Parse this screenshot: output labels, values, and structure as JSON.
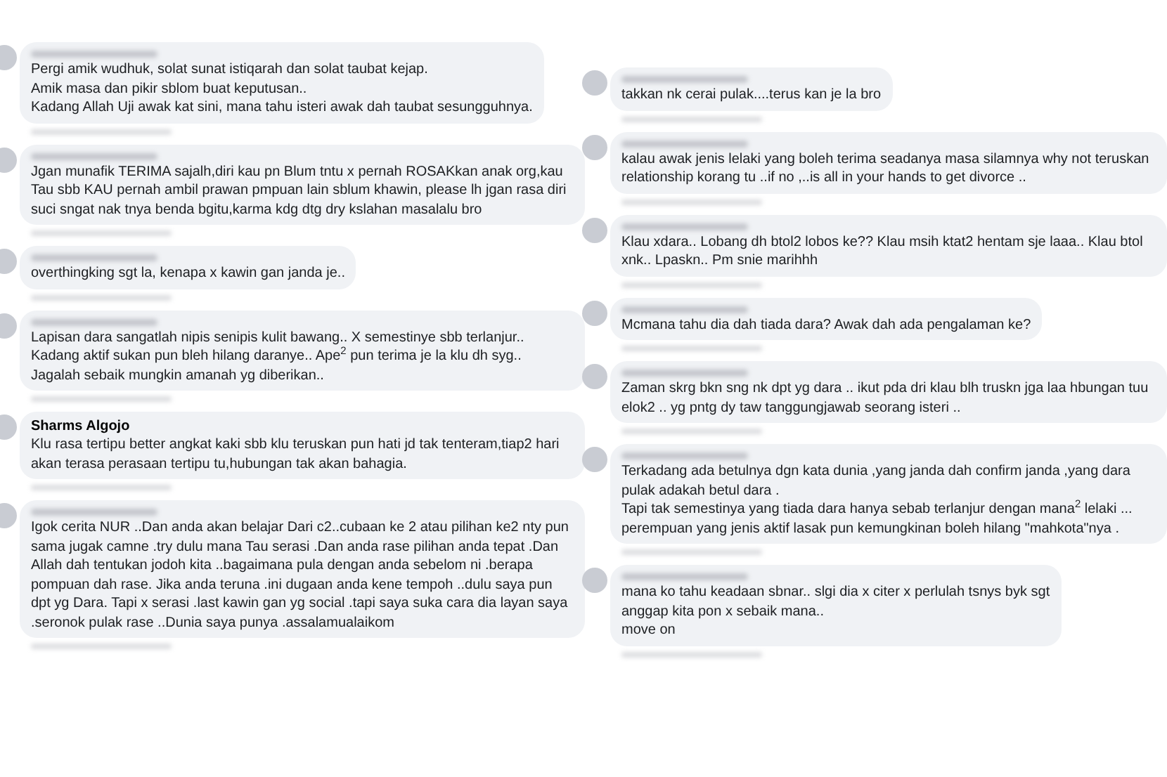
{
  "columns": [
    {
      "comments": [
        {
          "paragraphs": [
            "Pergi amik wudhuk, solat sunat istiqarah dan solat taubat kejap.",
            "Amik masa dan pikir sblom buat keputusan..",
            "Kadang Allah Uji awak kat sini, mana tahu isteri awak dah taubat sesungguhnya."
          ]
        },
        {
          "paragraphs": [
            "Jgan munafik TERIMA sajalh,diri kau pn Blum tntu x pernah ROSAKkan anak org,kau Tau sbb KAU pernah ambil prawan pmpuan lain sblum khawin, please lh jgan rasa diri suci sngat nak tnya benda bgitu,karma kdg dtg dry kslahan masalalu bro"
          ]
        },
        {
          "paragraphs": [
            "overthingking sgt la, kenapa x kawin gan janda je.."
          ]
        },
        {
          "paragraphs": [
            "Lapisan dara sangatlah nipis senipis kulit bawang.. X semestinye sbb terlanjur.. Kadang aktif sukan pun bleh hilang daranye.. Ape$^{2}$ pun terima je la klu dh syg.. Jagalah sebaik mungkin amanah yg diberikan.."
          ]
        },
        {
          "author": "Sharms Algojo",
          "paragraphs": [
            "Klu rasa tertipu better angkat kaki sbb klu teruskan pun hati jd tak tenteram,tiap2 hari akan terasa perasaan tertipu tu,hubungan tak akan bahagia."
          ]
        },
        {
          "paragraphs": [
            "Igok cerita NUR ..Dan anda akan belajar Dari c2..cubaan ke 2 atau pilihan ke2 nty pun sama jugak camne .try dulu mana Tau serasi .Dan anda rase pilihan anda tepat .Dan Allah dah tentukan jodoh kita ..bagaimana pula dengan anda sebelom ni .berapa pompuan dah rase. Jika anda teruna .ini dugaan anda kene tempoh ..dulu saya pun dpt yg Dara. Tapi x serasi .last kawin gan yg social .tapi saya suka cara dia layan saya .seronok pulak rase ..Dunia saya punya .assalamualaikom"
          ]
        }
      ]
    },
    {
      "comments": [
        {
          "paragraphs": [
            "takkan nk cerai pulak....terus kan je la bro"
          ]
        },
        {
          "paragraphs": [
            "kalau awak jenis lelaki yang boleh terima seadanya masa silamnya why not teruskan relationship korang tu ..if no ,..is all in your hands to get divorce .."
          ]
        },
        {
          "paragraphs": [
            "Klau xdara.. Lobang dh btol2 lobos ke?? Klau msih ktat2 hentam sje laaa.. Klau btol xnk.. Lpaskn.. Pm snie marihhh"
          ]
        },
        {
          "paragraphs": [
            "Mcmana tahu dia dah tiada dara? Awak dah ada pengalaman ke?"
          ]
        },
        {
          "paragraphs": [
            "Zaman skrg bkn sng nk dpt yg dara .. ikut pda dri klau blh truskn jga laa hbungan tuu elok2 .. yg pntg dy taw tanggungjawab seorang isteri .."
          ]
        },
        {
          "paragraphs": [
            "Terkadang ada betulnya dgn kata dunia ,yang janda dah confirm janda ,yang dara pulak adakah betul dara .",
            "Tapi tak semestinya yang tiada dara hanya sebab terlanjur dengan mana$^{2}$ lelaki ... perempuan yang jenis aktif lasak pun kemungkinan boleh hilang \"mahkota\"nya ."
          ]
        },
        {
          "paragraphs": [
            "mana ko tahu keadaan sbnar.. slgi dia x citer x perlulah tsnys byk sgt",
            "anggap kita pon x sebaik mana..",
            "move on"
          ]
        }
      ]
    }
  ]
}
